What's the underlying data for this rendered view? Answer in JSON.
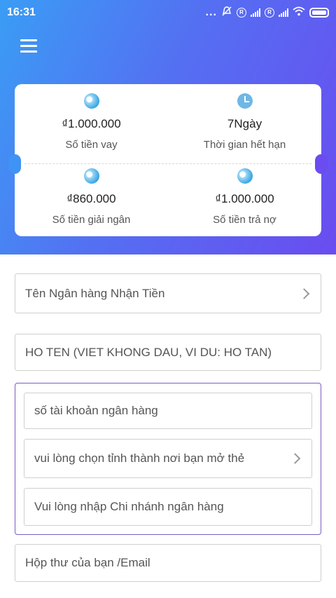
{
  "status_bar": {
    "time": "16:31",
    "dots": "...",
    "sim_marker": "R",
    "icons": [
      "alarm-off-icon",
      "signal-icon",
      "signal-icon",
      "wifi-icon",
      "battery-icon"
    ]
  },
  "header": {
    "menu_icon": "hamburger-icon"
  },
  "summary_card": {
    "loan_amount": {
      "value": "₫1.000.000",
      "label": "Số tiền vay",
      "icon": "coin-icon"
    },
    "term": {
      "value": "7Ngày",
      "label": "Thời gian hết hạn",
      "icon": "clock-icon"
    },
    "disbursed_amount": {
      "value": "₫860.000",
      "label": "Số tiền giải ngân",
      "icon": "coin-icon"
    },
    "repay_amount": {
      "value": "₫1.000.000",
      "label": "Số tiền trả nợ",
      "icon": "coin-icon"
    }
  },
  "form": {
    "bank_select": "Tên Ngân hàng Nhận Tiền",
    "full_name_placeholder": "HO TEN (VIET KHONG DAU, VI DU: HO TAN)",
    "account_number_placeholder": "số tài khoản ngân hàng",
    "province_select": "vui lòng chọn tỉnh thành nơi bạn mở thẻ",
    "branch_placeholder": "Vui lòng nhập Chi nhánh ngân hàng",
    "email_placeholder": "Hộp thư của bạn /Email"
  },
  "colors": {
    "gradient_start": "#3a9df5",
    "gradient_end": "#6a4cf0",
    "group_border": "#7b5cc0"
  }
}
